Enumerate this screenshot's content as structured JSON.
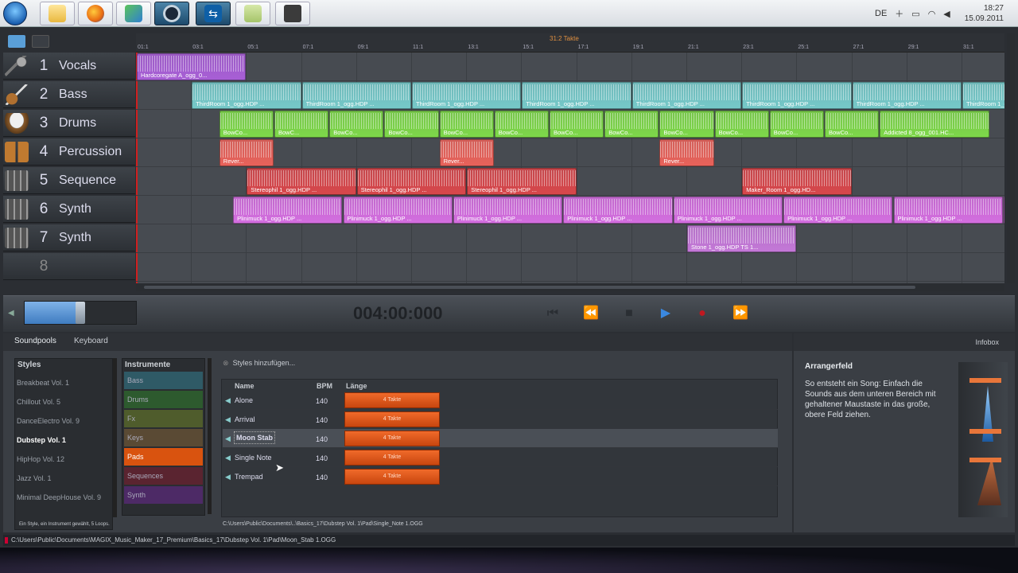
{
  "taskbar": {
    "apps": [
      "start-orb",
      "explorer",
      "firefox",
      "users",
      "steam",
      "teamviewer",
      "notepad",
      "media"
    ],
    "tray_lang": "DE",
    "time": "18:27",
    "date": "15.09.2011"
  },
  "ruler": {
    "marker_label": "31:2 Takte",
    "ticks": [
      "01:1",
      "03:1",
      "05:1",
      "07:1",
      "09:1",
      "11:1",
      "13:1",
      "15:1",
      "17:1",
      "19:1",
      "21:1",
      "23:1",
      "25:1",
      "27:1",
      "29:1",
      "31:1"
    ]
  },
  "tracks": [
    {
      "num": "1",
      "name": "Vocals",
      "icon": "microphone-icon",
      "color": "#a85fd6"
    },
    {
      "num": "2",
      "name": "Bass",
      "icon": "guitar-icon",
      "color": "#76c9c9"
    },
    {
      "num": "3",
      "name": "Drums",
      "icon": "drum-icon",
      "color": "#7ed84a"
    },
    {
      "num": "4",
      "name": "Percussion",
      "icon": "bongo-icon",
      "color": "#e8625a"
    },
    {
      "num": "5",
      "name": "Sequence",
      "icon": "mixer-icon",
      "color": "#d8474b"
    },
    {
      "num": "6",
      "name": "Synth",
      "icon": "mixer-icon",
      "color": "#d46ee0"
    },
    {
      "num": "7",
      "name": "Synth",
      "icon": "mixer-icon",
      "color": "#c478d8"
    },
    {
      "num": "8",
      "name": "",
      "icon": "empty-icon",
      "color": "#555"
    }
  ],
  "clips": {
    "vocals": [
      "Hardcoregate A_ogg_0..."
    ],
    "bass": [
      "ThirdRoom 1_ogg.HDP ...",
      "ThirdRoom 1_ogg.HDP ...",
      "ThirdRoom 1_ogg.HDP ...",
      "ThirdRoom 1_ogg.HDP ...",
      "ThirdRoom 1_ogg.HDP ...",
      "ThirdRoom 1_ogg.HDP ...",
      "ThirdRoom 1_ogg.HDP ...",
      "ThirdRoom 1_ogg.HDP ..."
    ],
    "drums": [
      "BowCo...",
      "BowC...",
      "BowCo...",
      "BowCo...",
      "BowCo...",
      "BowCo...",
      "BowCo...",
      "BowCo...",
      "BowCo...",
      "BowCo...",
      "BowCo...",
      "BowCo...",
      "Addicted 8_ogg_001.HC..."
    ],
    "percussion": [
      "Rever...",
      "Rever...",
      "Rever..."
    ],
    "sequence": [
      "Stereophil 1_ogg.HDP ...",
      "Stereophil 1_ogg.HDP ...",
      "Stereophil 1_ogg.HDP ...",
      "Maker_Room 1_ogg.HD..."
    ],
    "synth6": [
      "Plinimuck 1_ogg.HDP ...",
      "Plinimuck 1_ogg.HDP ...",
      "Plinimuck 1_ogg.HDP ...",
      "Plinimuck 1_ogg.HDP ...",
      "Plinimuck 1_ogg.HDP ...",
      "Plinimuck 1_ogg.HDP ...",
      "Plinimuck 1_ogg.HDP ...",
      "Plinimuck 1_ogg.HDP ..."
    ],
    "synth7": [
      "Stone 1_ogg.HDP  TS  1..."
    ]
  },
  "transport": {
    "time": "004:00:000",
    "buttons": [
      "skip-back-icon",
      "rewind-icon",
      "stop-icon",
      "play-icon",
      "record-icon",
      "fast-forward-icon"
    ]
  },
  "lower": {
    "tabs": [
      "Soundpools",
      "Keyboard"
    ],
    "infobox_tab": "Infobox",
    "styles_header": "Styles",
    "styles": [
      "Breakbeat Vol. 1",
      "Chillout Vol. 5",
      "DanceElectro Vol. 9",
      "Dubstep Vol. 1",
      "HipHop Vol. 12",
      "Jazz Vol. 1",
      "Minimal DeepHouse Vol. 9"
    ],
    "selected_style": "Dubstep Vol. 1",
    "instruments_header": "Instrumente",
    "instruments": [
      {
        "name": "Bass",
        "color": "#2f5a66"
      },
      {
        "name": "Drums",
        "color": "#2d5a2e"
      },
      {
        "name": "Fx",
        "color": "#4f5c2c"
      },
      {
        "name": "Keys",
        "color": "#5a4a34"
      },
      {
        "name": "Pads",
        "color": "#d9530f"
      },
      {
        "name": "Sequences",
        "color": "#5a2430"
      },
      {
        "name": "Synth",
        "color": "#4d2a66"
      }
    ],
    "add_styles": "Styles hinzufügen...",
    "loop_headers": {
      "name": "Name",
      "bpm": "BPM",
      "length": "Länge"
    },
    "loops": [
      {
        "name": "Alone",
        "bpm": "140",
        "length": "4 Takte"
      },
      {
        "name": "Arrival",
        "bpm": "140",
        "length": "4 Takte"
      },
      {
        "name": "Moon Stab",
        "bpm": "140",
        "length": "4 Takte"
      },
      {
        "name": "Single Note",
        "bpm": "140",
        "length": "4 Takte"
      },
      {
        "name": "Trempad",
        "bpm": "140",
        "length": "4 Takte"
      }
    ],
    "status_left": "Ein Style, ein Instrument gewählt, 5 Loops.",
    "status_path": "C:\\Users\\Public\\Documents\\..\\Basics_17\\Dubstep Vol. 1\\Pad\\Single_Note 1.OGG"
  },
  "infobox": {
    "title": "Arrangerfeld",
    "text": "So entsteht ein Song: Einfach die Sounds aus dem unteren Bereich mit gehaltener Maustaste in das große, obere Feld ziehen."
  },
  "statusbar": {
    "path": "C:\\Users\\Public\\Documents\\MAGIX_Music_Maker_17_Premium\\Basics_17\\Dubstep Vol. 1\\Pad\\Moon_Stab 1.OGG"
  }
}
